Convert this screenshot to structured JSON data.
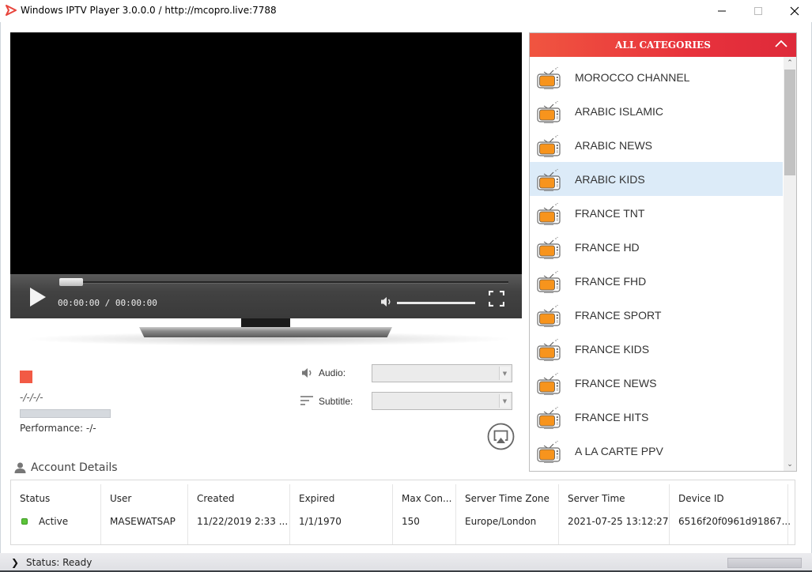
{
  "window": {
    "title": "Windows IPTV Player 3.0.0.0 / http://mcopro.live:7788",
    "app_icon": "play-triangle-icon",
    "minimize_icon": "minimize-icon",
    "maximize_icon": "maximize-icon",
    "close_icon": "close-icon"
  },
  "player": {
    "time_display": "00:00:00 / 00:00:00",
    "seek_progress": 0,
    "volume_level": 1.0,
    "play_icon": "play-icon",
    "volume_icon": "speaker-icon",
    "fullscreen_icon": "fullscreen-icon"
  },
  "stream_info": {
    "record_indicator_color": "#f25a45",
    "info_text": "-/-/-/-",
    "performance": "Performance: -/-"
  },
  "tracks": {
    "audio_label": "Audio:",
    "audio_value": "",
    "subtitle_label": "Subtitle:",
    "subtitle_value": "",
    "cast_icon": "airplay-icon"
  },
  "account": {
    "title": "Account Details",
    "columns": [
      "Status",
      "User",
      "Created",
      "Expired",
      "Max Con...",
      "Server Time Zone",
      "Server Time",
      "Device ID"
    ],
    "row": {
      "status": "Active",
      "user": "MASEWATSAP",
      "created": "11/22/2019 2:33 ...",
      "expired": "1/1/1970",
      "max_connections": "150",
      "server_time_zone": "Europe/London",
      "server_time": "2021-07-25 13:12:27",
      "device_id": "6516f20f0961d91867..."
    },
    "status_color": "#5cc43a"
  },
  "categories": {
    "header": "ALL CATEGORIES",
    "header_color": "#e8323c",
    "selected_index": 3,
    "items": [
      "MOROCCO CHANNEL",
      "ARABIC ISLAMIC",
      "ARABIC NEWS",
      "ARABIC KIDS",
      "FRANCE TNT",
      "FRANCE HD",
      "FRANCE FHD",
      "FRANCE SPORT",
      "FRANCE KIDS",
      "FRANCE NEWS",
      "FRANCE HITS",
      "A LA CARTE PPV"
    ]
  },
  "statusbar": {
    "text": "Status: Ready"
  }
}
